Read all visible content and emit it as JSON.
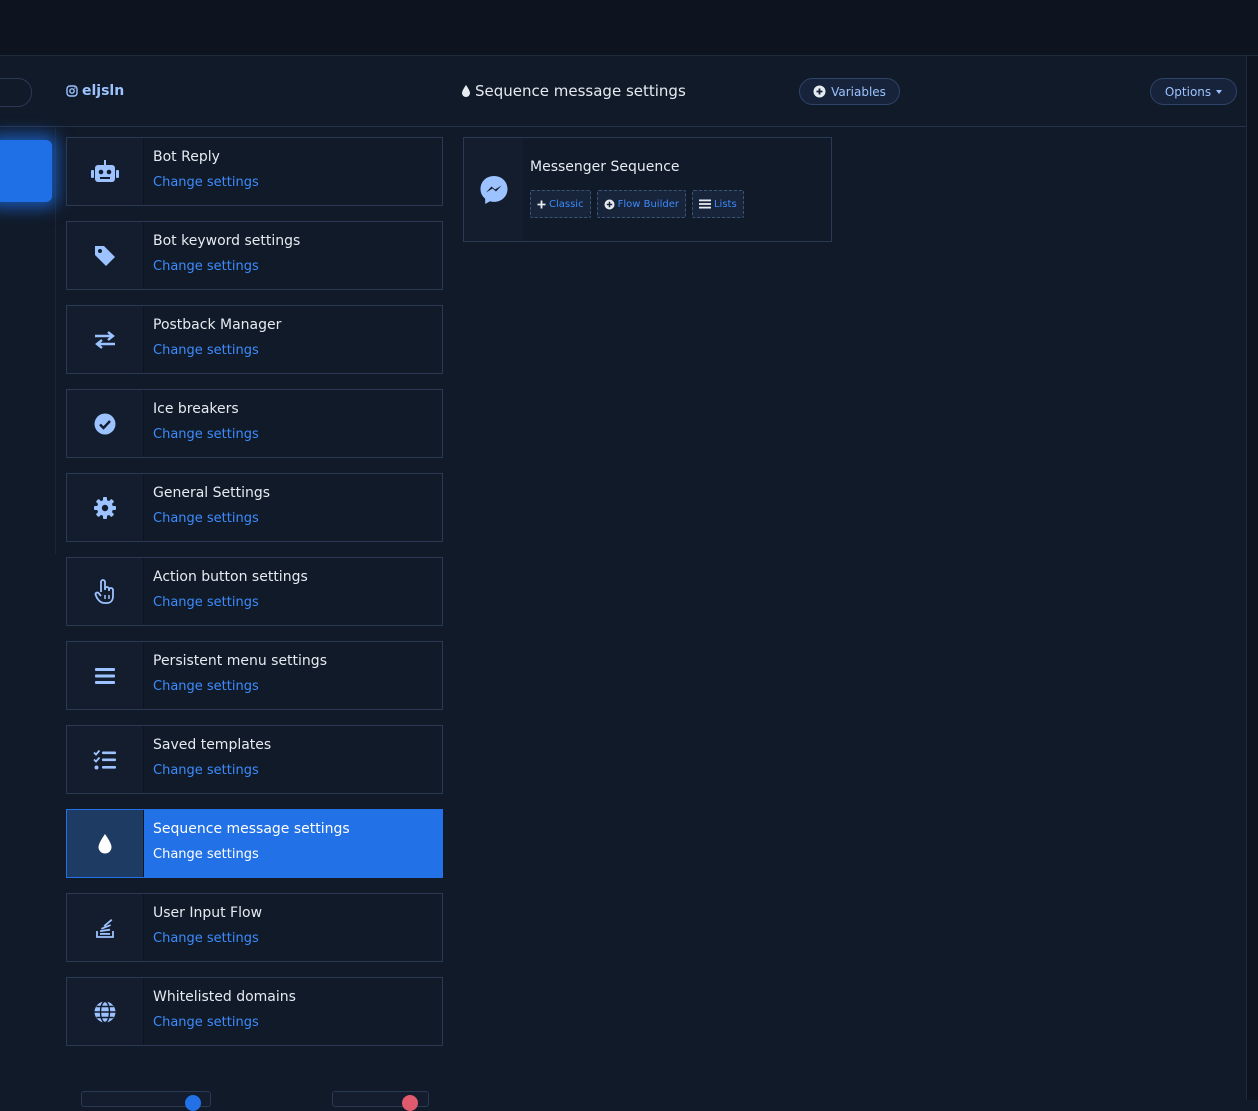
{
  "header": {
    "account_name": "eljsln",
    "page_title": "Sequence message settings",
    "variables_label": "Variables",
    "options_label": "Options"
  },
  "menu": {
    "items": [
      {
        "title": "Bot Reply",
        "subtitle": "Change settings",
        "icon": "robot-icon"
      },
      {
        "title": "Bot keyword settings",
        "subtitle": "Change settings",
        "icon": "tag-icon"
      },
      {
        "title": "Postback Manager",
        "subtitle": "Change settings",
        "icon": "exchange-icon"
      },
      {
        "title": "Ice breakers",
        "subtitle": "Change settings",
        "icon": "check-circle-icon"
      },
      {
        "title": "General Settings",
        "subtitle": "Change settings",
        "icon": "gear-icon"
      },
      {
        "title": "Action button settings",
        "subtitle": "Change settings",
        "icon": "hand-pointer-icon"
      },
      {
        "title": "Persistent menu settings",
        "subtitle": "Change settings",
        "icon": "bars-icon"
      },
      {
        "title": "Saved templates",
        "subtitle": "Change settings",
        "icon": "tasks-icon"
      },
      {
        "title": "Sequence message settings",
        "subtitle": "Change settings",
        "icon": "droplet-icon",
        "active": true
      },
      {
        "title": "User Input Flow",
        "subtitle": "Change settings",
        "icon": "stack-icon"
      },
      {
        "title": "Whitelisted domains",
        "subtitle": "Change settings",
        "icon": "globe-icon"
      }
    ]
  },
  "card": {
    "title": "Messenger Sequence",
    "icon": "messenger-icon",
    "chips": {
      "classic": "Classic",
      "flow_builder": "Flow Builder",
      "lists": "Lists"
    }
  },
  "colors": {
    "background": "#111a28",
    "accent": "#2271e6",
    "link": "#3d8bfd",
    "border": "#2a3a55"
  }
}
